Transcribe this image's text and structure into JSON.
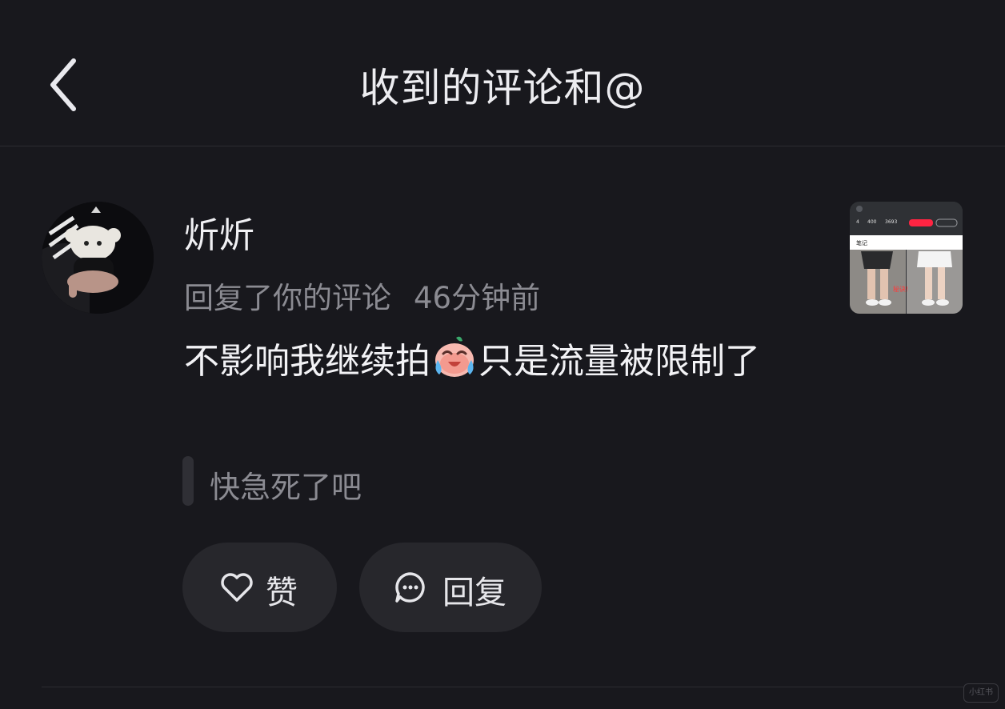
{
  "header": {
    "title": "收到的评论和@",
    "back_icon": "chevron-left-icon"
  },
  "notification": {
    "username": "炘炘",
    "action": "回复了你的评论",
    "time": "46分钟前",
    "comment_part1": "不影响我继续拍",
    "comment_emoji": "crying-laughing-emoji",
    "comment_part2": "只是流量被限制了",
    "quoted_comment": "快急死了吧",
    "thumbnail": {
      "stats": [
        "4",
        "400",
        "3693"
      ],
      "tab_label": "笔记",
      "overlay_text": "秘诀!"
    }
  },
  "actions": {
    "like_label": "赞",
    "like_icon": "heart-icon",
    "reply_label": "回复",
    "reply_icon": "comment-bubble-icon"
  },
  "watermark": "小红书",
  "colors": {
    "background": "#18181d",
    "button_bg": "#27272c",
    "muted_text": "#8b8b92",
    "accent": "#ff2442"
  }
}
